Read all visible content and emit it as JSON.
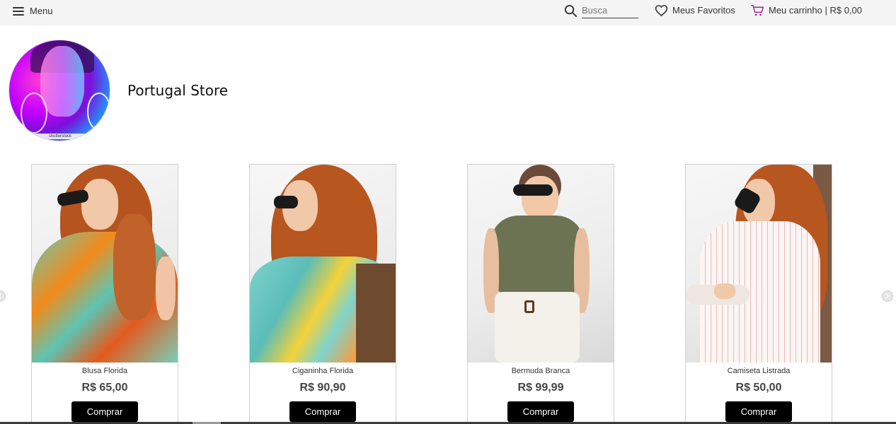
{
  "header": {
    "menu_label": "Menu",
    "search_placeholder": "Busca",
    "favorites_label": "Meus Favoritos",
    "cart_label": "Meu carrinho | R$ 0,00",
    "icons": {
      "menu": "hamburger-icon",
      "search": "search-icon",
      "favorites": "heart-icon",
      "cart": "cart-icon"
    },
    "accent_color": "#a020a0"
  },
  "store": {
    "name": "Portugal Store",
    "logo_watermark": "shutterstock"
  },
  "products": [
    {
      "name": "Blusa Florida",
      "price": "R$ 65,00",
      "button": "Comprar"
    },
    {
      "name": "Ciganinha Florida",
      "price": "R$ 90,90",
      "button": "Comprar"
    },
    {
      "name": "Bermuda Branca",
      "price": "R$ 99,99",
      "button": "Comprar"
    },
    {
      "name": "Camiseta Listrada",
      "price": "R$ 50,00",
      "button": "Comprar"
    }
  ]
}
